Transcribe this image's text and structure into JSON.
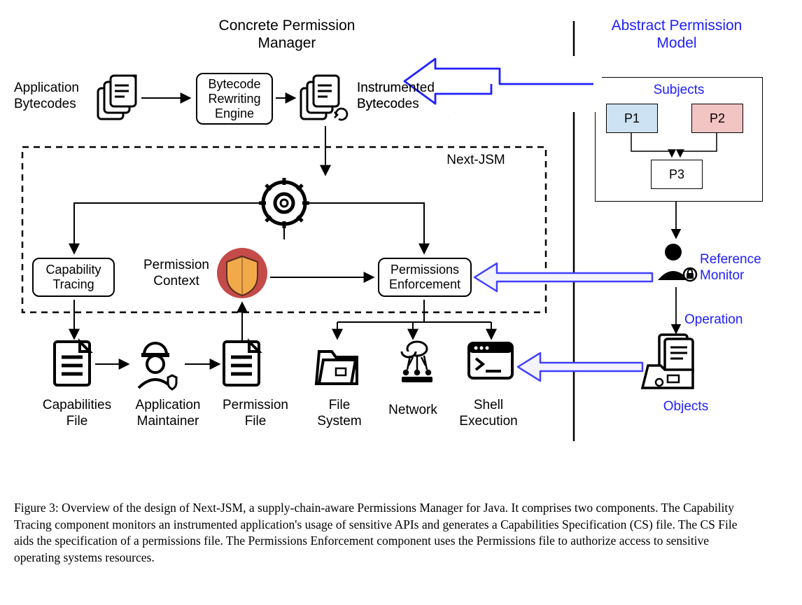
{
  "headers": {
    "concrete": "Concrete Permission\nManager",
    "abstract": "Abstract Permission\nModel"
  },
  "nodes": {
    "app_bytecodes": "Application\nBytecodes",
    "rewriting_engine": "Bytecode\nRewriting\nEngine",
    "instrumented": "Instrumented\nBytecodes",
    "nextjsm": "Next-JSM",
    "cap_tracing": "Capability\nTracing",
    "perm_context": "Permission\nContext",
    "perm_enforce": "Permissions\nEnforcement",
    "cap_file": "Capabilities\nFile",
    "app_maintainer": "Application\nMaintainer",
    "perm_file": "Permission\nFile",
    "file_system": "File\nSystem",
    "network": "Network",
    "shell_exec": "Shell\nExecution",
    "subjects": "Subjects",
    "p1": "P1",
    "p2": "P2",
    "p3": "P3",
    "ref_monitor": "Reference\nMonitor",
    "operation": "Operation",
    "objects": "Objects"
  },
  "caption": "Figure 3: Overview of the design of Next-JSM, a supply-chain-aware Permissions Manager for Java. It comprises two components. The Capability Tracing component monitors an instrumented application's usage of sensitive APIs and generates a Capabilities Specification (CS) file. The CS File aids the specification of a permissions file. The Permissions Enforcement component uses the Permissions file to authorize access to sensitive operating systems resources."
}
